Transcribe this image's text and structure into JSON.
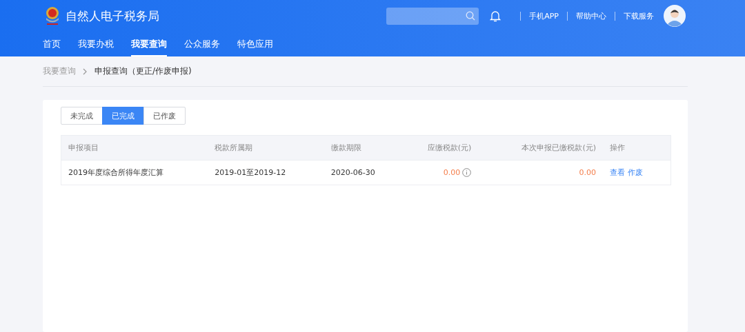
{
  "header": {
    "title": "自然人电子税务局",
    "links": [
      "手机APP",
      "帮助中心",
      "下载服务"
    ]
  },
  "nav": [
    {
      "label": "首页",
      "selected": false
    },
    {
      "label": "我要办税",
      "selected": false
    },
    {
      "label": "我要查询",
      "selected": true
    },
    {
      "label": "公众服务",
      "selected": false
    },
    {
      "label": "特色应用",
      "selected": false
    }
  ],
  "breadcrumb": [
    "我要查询",
    "申报查询（更正/作废申报)"
  ],
  "status_tabs": [
    {
      "label": "未完成",
      "selected": false
    },
    {
      "label": "已完成",
      "selected": true
    },
    {
      "label": "已作废",
      "selected": false
    }
  ],
  "table": {
    "columns": [
      "申报项目",
      "税款所属期",
      "缴款期限",
      "应缴税款(元)",
      "本次申报已缴税款(元)",
      "操作"
    ],
    "rows": [
      {
        "item": "2019年度综合所得年度汇算",
        "period": "2019-01至2019-12",
        "deadline": "2020-06-30",
        "tax_due": "0.00",
        "tax_paid": "0.00",
        "actions": [
          "查看",
          "作废"
        ]
      }
    ]
  }
}
